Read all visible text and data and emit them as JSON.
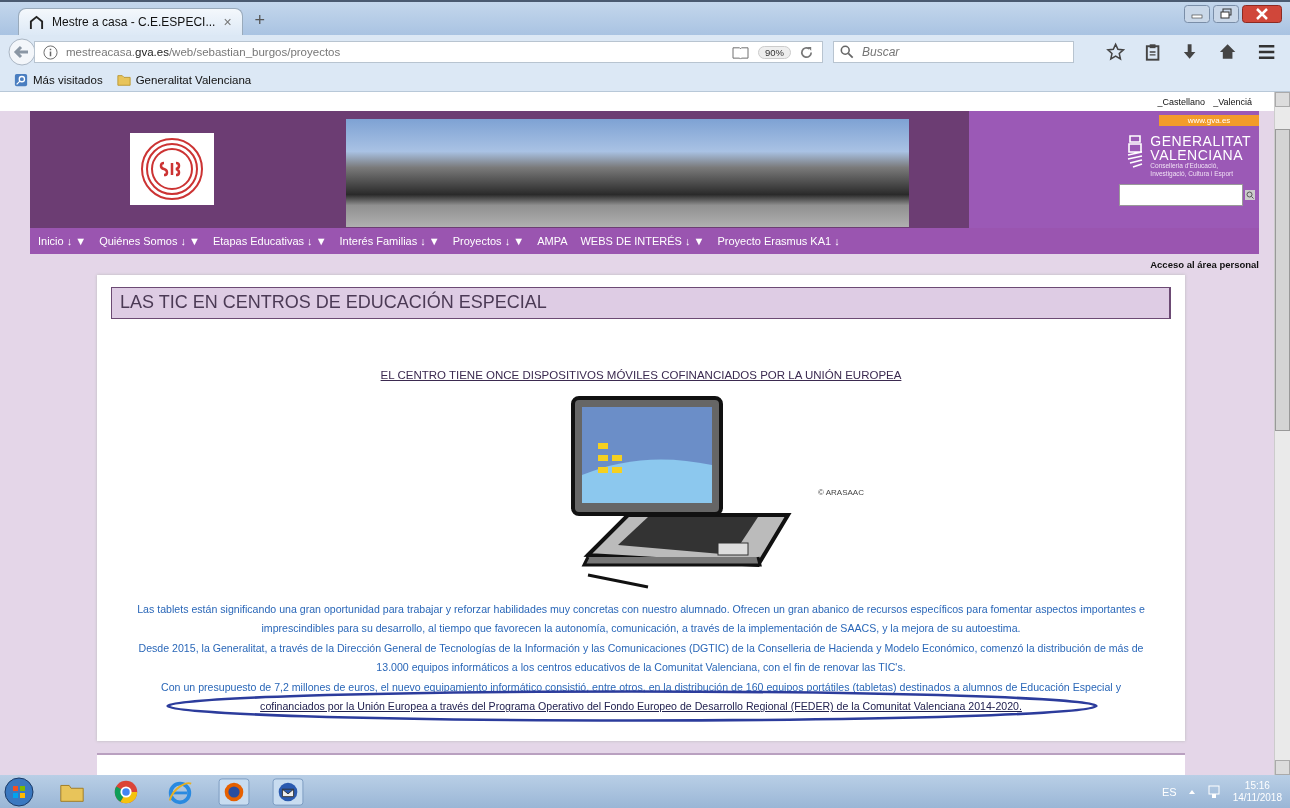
{
  "browser": {
    "tab": {
      "title": "Mestre a casa - C.E.ESPECI...",
      "close": "×",
      "selected": true
    },
    "new_tab": "+",
    "address": {
      "url_pre": "mestreacasa.",
      "url_domain": "gva.es",
      "url_post": "/web/sebastian_burgos/proyectos"
    },
    "zoom": "90%",
    "search": {
      "placeholder": "Buscar"
    },
    "bookmarks": [
      "Más visitados",
      "Generalitat Valenciana"
    ]
  },
  "page": {
    "language_links": [
      "_Castellano",
      "_Valenciá"
    ],
    "gva": {
      "badge": "www.gva.es",
      "name": [
        "GENERALITAT",
        "VALENCIANA"
      ],
      "subtitle": [
        "Conselleria d'Educació,",
        "Investigació, Cultura i Esport"
      ]
    },
    "nav": [
      "Inicio ↓ ▼",
      "Quiénes Somos ↓ ▼",
      "Etapas Educativas ↓ ▼",
      "Interés Familias ↓ ▼",
      "Proyectos ↓ ▼",
      "AMPA",
      "WEBS DE INTERÉS ↓ ▼",
      "Proyecto Erasmus KA1 ↓"
    ],
    "access_link": "Acceso al área personal",
    "article": {
      "title": "LAS TIC EN CENTROS DE EDUCACIÓN ESPECIAL",
      "headline": "EL CENTRO TIENE ONCE DISPOSITIVOS MÓVILES COFINANCIADOS POR LA UNIÓN EUROPEA",
      "image_credit": "© ARASAAC",
      "paragraphs": [
        "Las tablets están significando una gran oportunidad para trabajar y reforzar habilidades muy concretas con nuestro alumnado. Ofrecen un gran abanico de recursos específicos para fomentar aspectos importantes e imprescindibles para su desarrollo, al tiempo que favorecen la autonomía, comunicación, a través de la implementación de SAACS,  y la mejora de su autoestima.",
        "Desde 2015, la Generalitat,  a través de la Dirección General de Tecnologías de la Información y las Comunicaciones (DGTIC) de la Conselleria de Hacienda y Modelo Económico,  comenzó la distribución de más de 13.000 equipos informáticos a los centros educativos de la Comunitat Valenciana, con el fin de renovar las TIC's.",
        "Con un presupuesto de 7,2 millones de euros, el nuevo equipamiento informático consistió, entre otros, en la distribución de 160 equipos portátiles (tabletas) destinados a alumnos de Educación Especial y"
      ],
      "link": "cofinanciados por la Unión Europea a través del Programa Operativo del Fondo Europeo de Desarrollo Regional (FEDER) de la Comunitat Valenciana  2014-2020."
    }
  },
  "taskbar": {
    "language": "ES",
    "time": "15:16",
    "date": "14/11/2018"
  }
}
